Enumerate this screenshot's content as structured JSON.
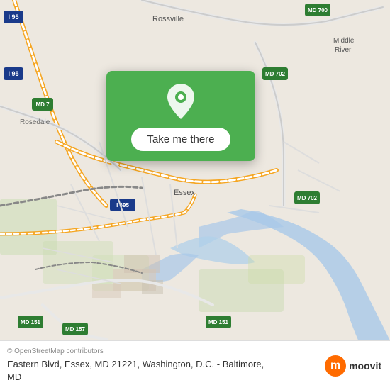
{
  "map": {
    "background_color": "#ede8e0",
    "overlay_card": {
      "background_color": "#4caf50",
      "button_label": "Take me there"
    }
  },
  "bottom_bar": {
    "attribution": "© OpenStreetMap contributors",
    "location_text": "Eastern Blvd, Essex, MD 21221, Washington, D.C. - Baltimore, MD",
    "moovit_label": "moovit"
  },
  "pin": {
    "color": "white",
    "background": "#4caf50"
  }
}
